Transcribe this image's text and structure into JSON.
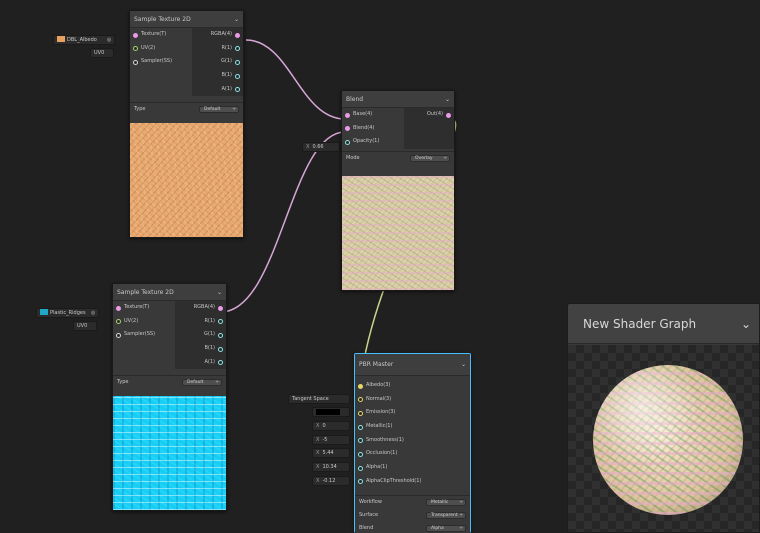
{
  "nodes": {
    "sample1": {
      "title": "Sample Texture 2D",
      "inputs": [
        "Texture(T)",
        "UV(2)",
        "Sampler(SS)"
      ],
      "outputs": [
        "RGBA(4)",
        "R(1)",
        "G(1)",
        "B(1)",
        "A(1)"
      ],
      "type_label": "Type",
      "type_value": "Default",
      "texture_field": "DBL_Albedo",
      "uv_field": "UV0"
    },
    "sample2": {
      "title": "Sample Texture 2D",
      "inputs": [
        "Texture(T)",
        "UV(2)",
        "Sampler(SS)"
      ],
      "outputs": [
        "RGBA(4)",
        "R(1)",
        "G(1)",
        "B(1)",
        "A(1)"
      ],
      "type_label": "Type",
      "type_value": "Default",
      "texture_field": "Plastic_Ridges",
      "uv_field": "UV0"
    },
    "blend": {
      "title": "Blend",
      "inputs": [
        "Base(4)",
        "Blend(4)",
        "Opacity(1)"
      ],
      "outputs": [
        "Out(4)"
      ],
      "mode_label": "Mode",
      "mode_value": "Overlay",
      "opacity_x": "X",
      "opacity_value": "0.66"
    },
    "pbr": {
      "title": "PBR Master",
      "inputs": [
        "Albedo(3)",
        "Normal(3)",
        "Emission(3)",
        "Metallic(1)",
        "Smoothness(1)",
        "Occlusion(1)",
        "Alpha(1)",
        "AlphaClipThreshold(1)"
      ],
      "normal_field": "Tangent Space",
      "metallic_x": "X",
      "metallic_value": "0",
      "smoothness_x": "X",
      "smoothness_value": "-5",
      "occlusion_x": "X",
      "occlusion_value": "5.44",
      "alpha_x": "X",
      "alpha_value": "10.34",
      "clip_x": "X",
      "clip_value": "-0.12",
      "settings": [
        {
          "label": "Workflow",
          "value": "Metallic"
        },
        {
          "label": "Surface",
          "value": "Transparent"
        },
        {
          "label": "Blend",
          "value": "Alpha"
        }
      ]
    }
  },
  "main_preview": {
    "title": "New Shader Graph"
  },
  "colors": {
    "canvas": "#202020",
    "node": "#393939",
    "selected_border": "#44c0ff",
    "edge_color": "#d6a6d6",
    "edge_albedo": "#c8d48a",
    "texture_swatch_1": "#e8a060",
    "texture_swatch_2": "#20a8c8",
    "emission_color": "#000000"
  },
  "icons": {
    "chevron": "chevron-down-icon",
    "target": "target-icon"
  }
}
